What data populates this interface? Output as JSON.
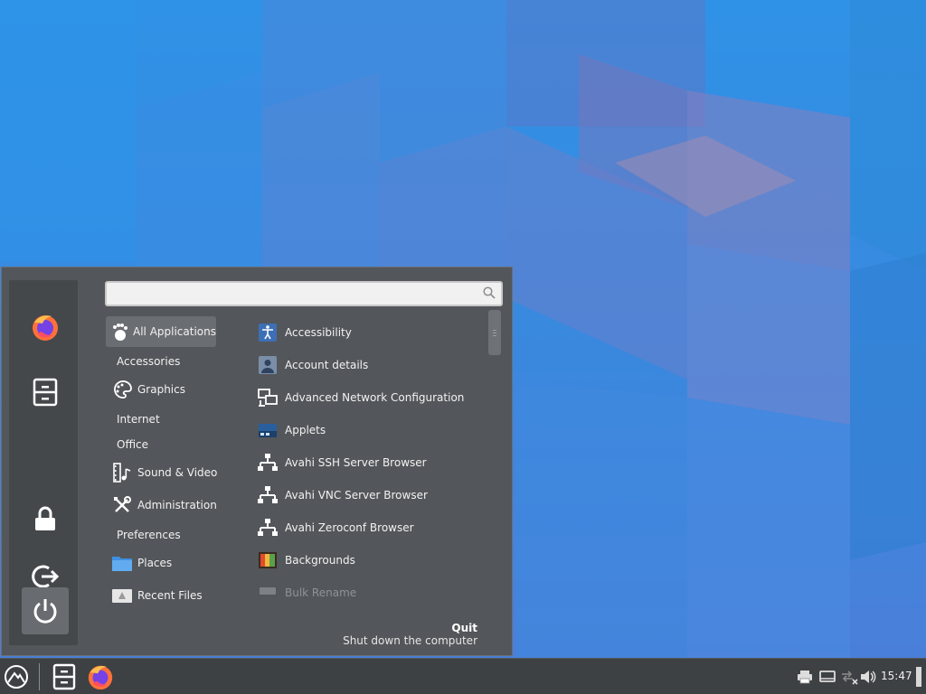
{
  "search": {
    "value": "",
    "placeholder": ""
  },
  "categories": [
    {
      "label": "All Applications",
      "icon": "gnome-foot-icon",
      "selected": true
    },
    {
      "label": "Accessories",
      "icon": ""
    },
    {
      "label": "Graphics",
      "icon": "palette-icon"
    },
    {
      "label": "Internet",
      "icon": ""
    },
    {
      "label": "Office",
      "icon": ""
    },
    {
      "label": "Sound & Video",
      "icon": "film-music-icon"
    },
    {
      "label": "Administration",
      "icon": "tools-icon"
    },
    {
      "label": "Preferences",
      "icon": ""
    },
    {
      "label": "Places",
      "icon": "folder-icon"
    },
    {
      "label": "Recent Files",
      "icon": "recent-files-icon"
    }
  ],
  "apps": [
    {
      "label": "Accessibility",
      "icon": "accessibility-icon"
    },
    {
      "label": "Account details",
      "icon": "user-account-icon"
    },
    {
      "label": "Advanced Network Configuration",
      "icon": "network-config-icon"
    },
    {
      "label": "Applets",
      "icon": "applets-icon"
    },
    {
      "label": "Avahi SSH Server Browser",
      "icon": "network-tree-icon"
    },
    {
      "label": "Avahi VNC Server Browser",
      "icon": "network-tree-icon"
    },
    {
      "label": "Avahi Zeroconf Browser",
      "icon": "network-tree-icon"
    },
    {
      "label": "Backgrounds",
      "icon": "backgrounds-icon"
    },
    {
      "label": "Bulk Rename",
      "icon": "bulk-rename-icon",
      "dimmed": true
    }
  ],
  "info": {
    "title": "Quit",
    "description": "Shut down the computer"
  },
  "sidebar": [
    "firefox-icon",
    "file-manager-icon",
    "lock-icon",
    "logout-icon",
    "power-icon"
  ],
  "panel": {
    "clock": "15:47"
  },
  "colors": {
    "menu_bg": "#53565a",
    "panel_bg": "#3e4144",
    "selected_bg": "#6a6d71",
    "desktop": "#3a88de"
  }
}
